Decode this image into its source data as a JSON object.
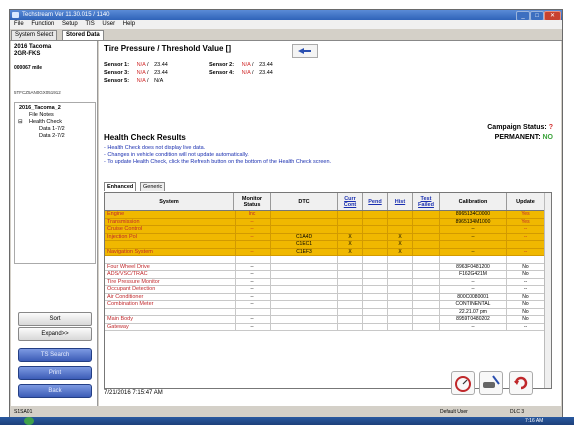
{
  "window": {
    "title": "Techstream Ver 11.30.015 / 1140"
  },
  "menu": [
    "File",
    "Function",
    "Setup",
    "TIS",
    "User",
    "Help"
  ],
  "tabs": [
    "System Select",
    "Stored Data"
  ],
  "vehicle": {
    "model": "2016 Tacoma",
    "engine": "2GR-FKS",
    "mileage": "000067 mile",
    "vin": "5TFCZ5AN0GX051912"
  },
  "tree": {
    "root": "2016_Tacoma_2",
    "item1": "File Notes",
    "item2": "Health Check",
    "item3": "Data 1-7/2",
    "item4": "Data 2-7/2"
  },
  "left_buttons": {
    "sort": "Sort",
    "expand": "Expand>>",
    "ts_search": "TS Search",
    "print": "Print",
    "back": "Back"
  },
  "tpms": {
    "title": "Tire Pressure / Threshold Value []",
    "sensor1": {
      "label": "Sensor 1:",
      "value": "N/A",
      "threshold": "23.44"
    },
    "sensor2": {
      "label": "Sensor 2:",
      "value": "N/A",
      "threshold": "23.44"
    },
    "sensor3": {
      "label": "Sensor 3:",
      "value": "N/A",
      "threshold": "23.44"
    },
    "sensor4": {
      "label": "Sensor 4:",
      "value": "N/A",
      "threshold": "23.44"
    },
    "sensor5": {
      "label": "Sensor 5:",
      "value": "N/A",
      "threshold": "N/A"
    }
  },
  "campaign": {
    "label": "Campaign Status:",
    "status_mark": "?",
    "permanent_label": "PERMANENT:",
    "permanent_value": "NO"
  },
  "health_check": {
    "title": "Health Check Results",
    "note1": "- Health Check does not display live data.",
    "note2": "- Changes in vehicle condition will not update automatically.",
    "note3": "- To update Health Check, click the Refresh button on the bottom of the Health Check screen."
  },
  "subtabs": [
    "Enhanced",
    "Generic"
  ],
  "columns": {
    "system": "System",
    "monitor": "Monitor Status",
    "dtc": "DTC",
    "curr": "Curr Cont",
    "pend": "Pend",
    "hist": "Hist",
    "test": "Test Failed",
    "calibration": "Calibration",
    "update": "Update"
  },
  "rows": [
    {
      "system": "Engine",
      "monitor": "Inc",
      "dtc": "",
      "curr": "",
      "pend": "",
      "hist": "",
      "test": "",
      "calibration": "8965134C0000",
      "update": "Yes",
      "hl": true
    },
    {
      "system": "Transmission",
      "monitor": "--",
      "dtc": "",
      "curr": "",
      "pend": "",
      "hist": "",
      "test": "",
      "calibration": "8965134M1000",
      "update": "Yes",
      "hl": true
    },
    {
      "system": "Cruise Control",
      "monitor": "--",
      "dtc": "",
      "curr": "",
      "pend": "",
      "hist": "",
      "test": "",
      "calibration": "--",
      "update": "--",
      "hl": true
    },
    {
      "system": "Injection Pol",
      "monitor": "--",
      "dtc": "C1A4D",
      "curr": "X",
      "pend": "",
      "hist": "X",
      "test": "",
      "calibration": "--",
      "update": "--",
      "hl": true
    },
    {
      "system": "",
      "monitor": "",
      "dtc": "C1EC1",
      "curr": "X",
      "pend": "",
      "hist": "X",
      "test": "",
      "calibration": "",
      "update": "",
      "hl": true
    },
    {
      "system": "Navigation System",
      "monitor": "--",
      "dtc": "C1EF3",
      "curr": "X",
      "pend": "",
      "hist": "X",
      "test": "",
      "calibration": "--",
      "update": "--",
      "hl": true
    },
    {
      "system": "",
      "monitor": "",
      "dtc": "",
      "curr": "",
      "pend": "",
      "hist": "",
      "test": "",
      "calibration": "",
      "update": "",
      "hl": false
    },
    {
      "system": "Four Wheel Drive",
      "monitor": "--",
      "dtc": "",
      "curr": "",
      "pend": "",
      "hist": "",
      "test": "",
      "calibration": "8963F0481200",
      "update": "No",
      "hl": false
    },
    {
      "system": "ADS/VSC/TRAC",
      "monitor": "--",
      "dtc": "",
      "curr": "",
      "pend": "",
      "hist": "",
      "test": "",
      "calibration": "F162G421M",
      "update": "No",
      "hl": false
    },
    {
      "system": "Tire Pressure Monitor",
      "monitor": "--",
      "dtc": "",
      "curr": "",
      "pend": "",
      "hist": "",
      "test": "",
      "calibration": "--",
      "update": "--",
      "hl": false
    },
    {
      "system": "Occupant Detection",
      "monitor": "--",
      "dtc": "",
      "curr": "",
      "pend": "",
      "hist": "",
      "test": "",
      "calibration": "--",
      "update": "--",
      "hl": false
    },
    {
      "system": "Air Conditioner",
      "monitor": "--",
      "dtc": "",
      "curr": "",
      "pend": "",
      "hist": "",
      "test": "",
      "calibration": "800C0080001",
      "update": "No",
      "hl": false
    },
    {
      "system": "Combination Meter",
      "monitor": "--",
      "dtc": "",
      "curr": "",
      "pend": "",
      "hist": "",
      "test": "",
      "calibration": "CONTINENTAL",
      "update": "No",
      "hl": false
    },
    {
      "system": "",
      "monitor": "",
      "dtc": "",
      "curr": "",
      "pend": "",
      "hist": "",
      "test": "",
      "calibration": "22.21.07 pm",
      "update": "No",
      "hl": false
    },
    {
      "system": "Main Body",
      "monitor": "--",
      "dtc": "",
      "curr": "",
      "pend": "",
      "hist": "",
      "test": "",
      "calibration": "8959T0480202",
      "update": "No",
      "hl": false
    },
    {
      "system": "Gateway",
      "monitor": "--",
      "dtc": "",
      "curr": "",
      "pend": "",
      "hist": "",
      "test": "",
      "calibration": "--",
      "update": "--",
      "hl": false
    }
  ],
  "timestamp": "7/21/2016 7:15:47 AM",
  "status": {
    "left": "S1SA01",
    "user": "Default User",
    "code": "DLC 3"
  },
  "taskbar": {
    "time": "7:16 AM"
  }
}
